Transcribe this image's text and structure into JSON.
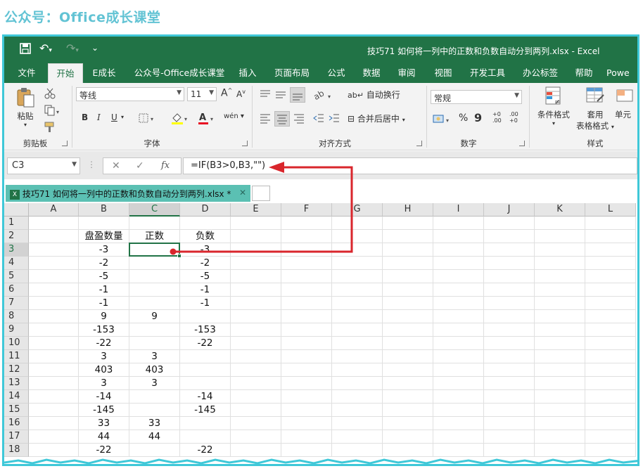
{
  "caption": "公众号：Office成长课堂",
  "window": {
    "title": "技巧71  如何将一列中的正数和负数自动分到两列.xlsx  -  Excel"
  },
  "tabs": [
    {
      "label": "文件"
    },
    {
      "label": "开始"
    },
    {
      "label": "E成长"
    },
    {
      "label": "公众号-Office成长课堂"
    },
    {
      "label": "插入"
    },
    {
      "label": "页面布局"
    },
    {
      "label": "公式"
    },
    {
      "label": "数据"
    },
    {
      "label": "审阅"
    },
    {
      "label": "视图"
    },
    {
      "label": "开发工具"
    },
    {
      "label": "办公标签"
    },
    {
      "label": "帮助"
    },
    {
      "label": "Powe"
    }
  ],
  "ribbon": {
    "clipboard": {
      "paste": "粘贴",
      "group": "剪贴板"
    },
    "font": {
      "name": "等线",
      "size": "11",
      "group": "字体",
      "grow": "A",
      "shrink": "A",
      "bold": "B",
      "italic": "I",
      "underline": "U",
      "pinyin": "wén"
    },
    "alignment": {
      "wrap": "自动换行",
      "merge": "合并后居中",
      "group": "对齐方式"
    },
    "number": {
      "format": "常规",
      "percent": "%",
      "comma": "9",
      "group": "数字",
      "inc_decimal": "+0 .00",
      "dec_decimal": ".00 +0"
    },
    "styles": {
      "conditional": "条件格式",
      "table_line1": "套用",
      "table_line2": "表格格式",
      "cell": "单元",
      "group": "样式"
    }
  },
  "formula_bar": {
    "name_box": "C3",
    "formula": "=IF(B3>0,B3,\"\")"
  },
  "doc_tab": {
    "label": "技巧71  如何将一列中的正数和负数自动分到两列.xlsx *"
  },
  "columns": [
    "A",
    "B",
    "C",
    "D",
    "E",
    "F",
    "G",
    "H",
    "I",
    "J",
    "K",
    "L"
  ],
  "rows": [
    {
      "n": "1",
      "B": "",
      "C": "",
      "D": ""
    },
    {
      "n": "2",
      "B": "盘盈数量",
      "C": "正数",
      "D": "负数"
    },
    {
      "n": "3",
      "B": "-3",
      "C": "",
      "D": "-3"
    },
    {
      "n": "4",
      "B": "-2",
      "C": "",
      "D": "-2"
    },
    {
      "n": "5",
      "B": "-5",
      "C": "",
      "D": "-5"
    },
    {
      "n": "6",
      "B": "-1",
      "C": "",
      "D": "-1"
    },
    {
      "n": "7",
      "B": "-1",
      "C": "",
      "D": "-1"
    },
    {
      "n": "8",
      "B": "9",
      "C": "9",
      "D": ""
    },
    {
      "n": "9",
      "B": "-153",
      "C": "",
      "D": "-153"
    },
    {
      "n": "10",
      "B": "-22",
      "C": "",
      "D": "-22"
    },
    {
      "n": "11",
      "B": "3",
      "C": "3",
      "D": ""
    },
    {
      "n": "12",
      "B": "403",
      "C": "403",
      "D": ""
    },
    {
      "n": "13",
      "B": "3",
      "C": "3",
      "D": ""
    },
    {
      "n": "14",
      "B": "-14",
      "C": "",
      "D": "-14"
    },
    {
      "n": "15",
      "B": "-145",
      "C": "",
      "D": "-145"
    },
    {
      "n": "16",
      "B": "33",
      "C": "33",
      "D": ""
    },
    {
      "n": "17",
      "B": "44",
      "C": "44",
      "D": ""
    },
    {
      "n": "18",
      "B": "-22",
      "C": "",
      "D": "-22"
    }
  ],
  "selected_cell": "C3",
  "colors": {
    "excel_green": "#217346",
    "frame": "#3fc8d8",
    "caption": "#62c3d4",
    "arrow": "#d9262c",
    "doc_tab": "#5bc0b3"
  }
}
